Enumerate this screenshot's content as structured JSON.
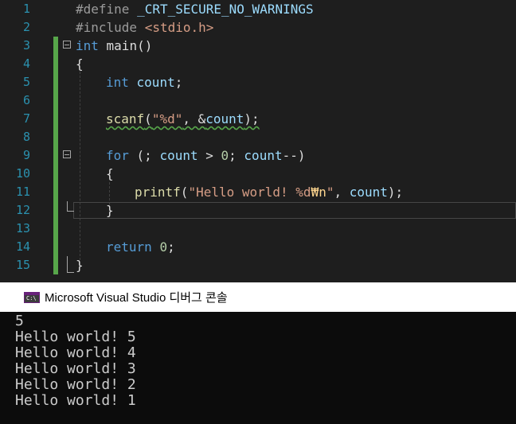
{
  "editor": {
    "line_numbers": [
      "1",
      "2",
      "3",
      "4",
      "5",
      "6",
      "7",
      "8",
      "9",
      "10",
      "11",
      "12",
      "13",
      "14",
      "15"
    ],
    "lines": {
      "l1": {
        "directive": "#define ",
        "macro": "_CRT_SECURE_NO_WARNINGS"
      },
      "l2": {
        "directive": "#include ",
        "header": "<stdio.h>"
      },
      "l3": {
        "type": "int",
        "name": " main()"
      },
      "l4": {
        "text": "{"
      },
      "l5": {
        "type": "int",
        "var": " count",
        "end": ";"
      },
      "l7": {
        "fn": "scanf",
        "open": "(",
        "fmt": "\"%d\"",
        "mid": ", &",
        "var": "count",
        "end": ");"
      },
      "l9": {
        "kw": "for",
        "a": " (; ",
        "var1": "count",
        "b": " > ",
        "zero": "0",
        "c": "; ",
        "var2": "count",
        "d": "--)"
      },
      "l10": {
        "text": "{"
      },
      "l11": {
        "fn": "printf",
        "open": "(",
        "str1": "\"Hello world! %d",
        "esc": "₩n",
        "str2": "\"",
        "mid": ", ",
        "var": "count",
        "end": ");"
      },
      "l12": {
        "text": "}"
      },
      "l14": {
        "kw": "return",
        "sp": " ",
        "zero": "0",
        "end": ";"
      },
      "l15": {
        "text": "}"
      }
    }
  },
  "console": {
    "title": "Microsoft Visual Studio 디버그 콘솔",
    "icon": "console-app-icon",
    "icon_glyph": "C:\\",
    "output": [
      "5",
      "Hello world! 5",
      "Hello world! 4",
      "Hello world! 3",
      "Hello world! 2",
      "Hello world! 1"
    ]
  },
  "colors": {
    "editor_bg": "#1e1e1e",
    "line_number": "#2b91af",
    "keyword": "#569cd6",
    "string": "#d69d85",
    "change_bar": "#57a64a",
    "console_bg": "#0c0c0c",
    "console_fg": "#cccccc"
  }
}
